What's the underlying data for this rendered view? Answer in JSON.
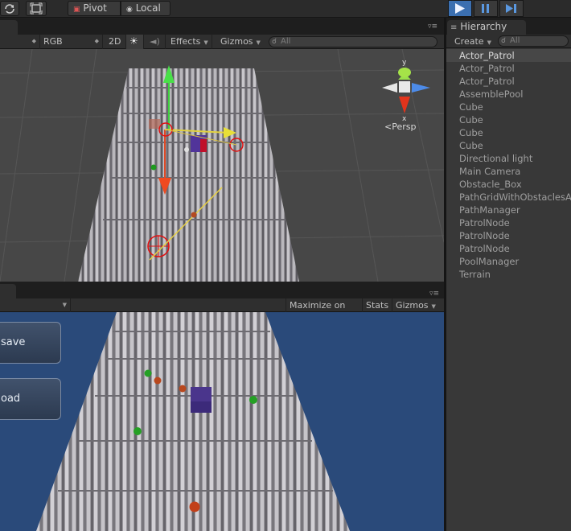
{
  "toolbar": {
    "pivot_label": "Pivot",
    "local_label": "Local",
    "play_icon": "play-icon",
    "pause_icon": "pause-icon",
    "step_icon": "step-icon"
  },
  "scene": {
    "render_mode": "",
    "color_mode": "RGB",
    "mode_2d": "2D",
    "effects_label": "Effects",
    "gizmos_label": "Gizmos",
    "search_placeholder": "All",
    "persp_label": "Persp",
    "axis_x": "x",
    "axis_y": "y"
  },
  "game": {
    "maximize_label": "Maximize on Play",
    "stats_label": "Stats",
    "gizmos_label": "Gizmos",
    "save_button": "save",
    "load_button": "oad"
  },
  "hierarchy": {
    "tab_label": "Hierarchy",
    "create_label": "Create",
    "search_placeholder": "All",
    "items": [
      "Actor_Patrol",
      "Actor_Patrol",
      "Actor_Patrol",
      "AssemblePool",
      "Cube",
      "Cube",
      "Cube",
      "Cube",
      "Directional light",
      "Main Camera",
      "Obstacle_Box",
      "PathGridWithObstaclesAr",
      "PathManager",
      "PatrolNode",
      "PatrolNode",
      "PatrolNode",
      "PoolManager",
      "Terrain"
    ],
    "selected_index": 0
  },
  "colors": {
    "accent_blue": "#3b6fb0",
    "selection": "#474747",
    "game_background": "#2a4a7a"
  }
}
